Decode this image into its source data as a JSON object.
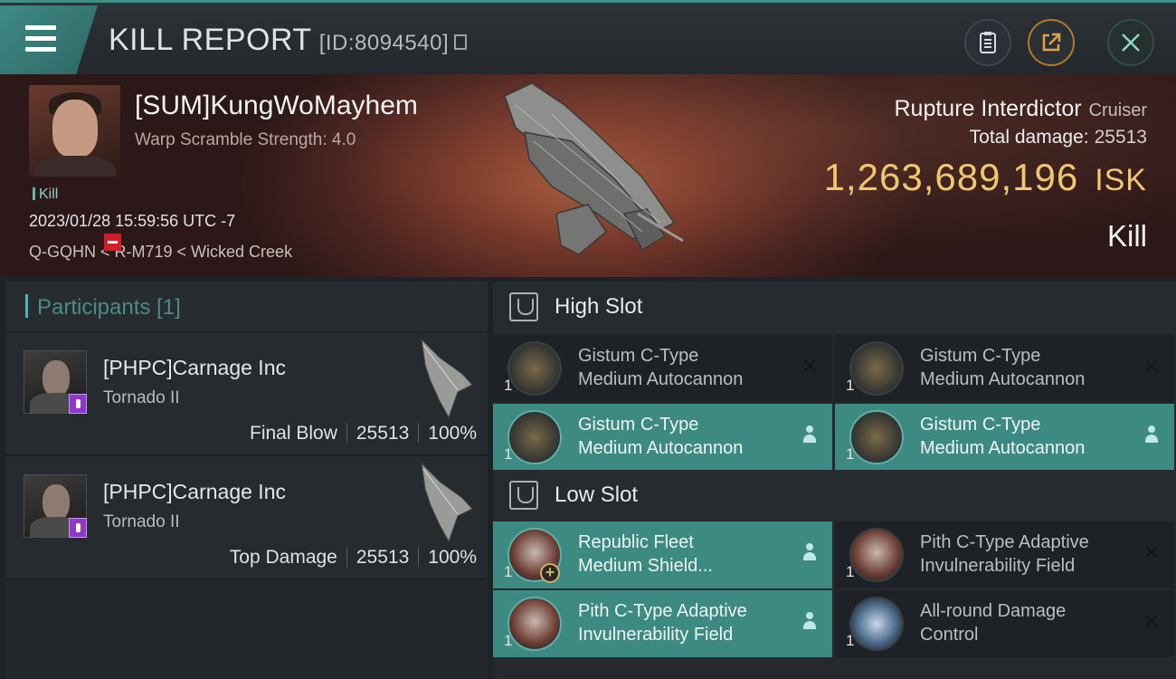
{
  "header": {
    "title": "KILL REPORT",
    "report_id": "[ID:8094540]"
  },
  "victim": {
    "name": "[SUM]KungWoMayhem",
    "scramble": "Warp Scramble Strength: 4.0",
    "kill_tag": "Kill",
    "datetime": "2023/01/28 15:59:56 UTC -7",
    "location": "Q-GQHN < R-M719 < Wicked Creek",
    "ship_name": "Rupture Interdictor",
    "ship_class": "Cruiser",
    "total_damage_label": "Total damage:",
    "total_damage": "25513",
    "isk_value": "1,263,689,196",
    "isk_unit": "ISK",
    "result": "Kill"
  },
  "participants": {
    "header": "Participants [1]",
    "items": [
      {
        "name": "[PHPC]Carnage Inc",
        "ship": "Tornado II",
        "role": "Final Blow",
        "damage": "25513",
        "percent": "100%"
      },
      {
        "name": "[PHPC]Carnage Inc",
        "ship": "Tornado II",
        "role": "Top Damage",
        "damage": "25513",
        "percent": "100%"
      }
    ]
  },
  "fitting": {
    "high_slot_label": "High Slot",
    "low_slot_label": "Low Slot",
    "high": [
      {
        "qty": "1",
        "line1": "Gistum C-Type",
        "line2": "Medium Autocannon",
        "state": "destroyed"
      },
      {
        "qty": "1",
        "line1": "Gistum C-Type",
        "line2": "Medium Autocannon",
        "state": "destroyed"
      },
      {
        "qty": "1",
        "line1": "Gistum C-Type",
        "line2": "Medium Autocannon",
        "state": "dropped"
      },
      {
        "qty": "1",
        "line1": "Gistum C-Type",
        "line2": "Medium Autocannon",
        "state": "dropped"
      }
    ],
    "low": [
      {
        "qty": "1",
        "line1": "Republic Fleet",
        "line2": "Medium Shield...",
        "state": "dropped"
      },
      {
        "qty": "1",
        "line1": "Pith C-Type Adaptive",
        "line2": "Invulnerability Field",
        "state": "destroyed"
      },
      {
        "qty": "1",
        "line1": "Pith C-Type Adaptive",
        "line2": "Invulnerability Field",
        "state": "dropped"
      },
      {
        "qty": "1",
        "line1": "All-round Damage",
        "line2": "Control",
        "state": "destroyed"
      }
    ]
  },
  "colors": {
    "accent": "#3f8a86",
    "isk": "#f2c670",
    "dropped_bg": "#3c8a81",
    "destroyed_bg": "#1e2226"
  },
  "icons": {
    "menu": "menu-icon",
    "copy": "copy-icon",
    "clipboard": "clipboard-icon",
    "export": "export-icon",
    "close": "close-icon",
    "slot": "slot-icon",
    "dropped": "person-icon",
    "destroyed": "x-icon"
  }
}
